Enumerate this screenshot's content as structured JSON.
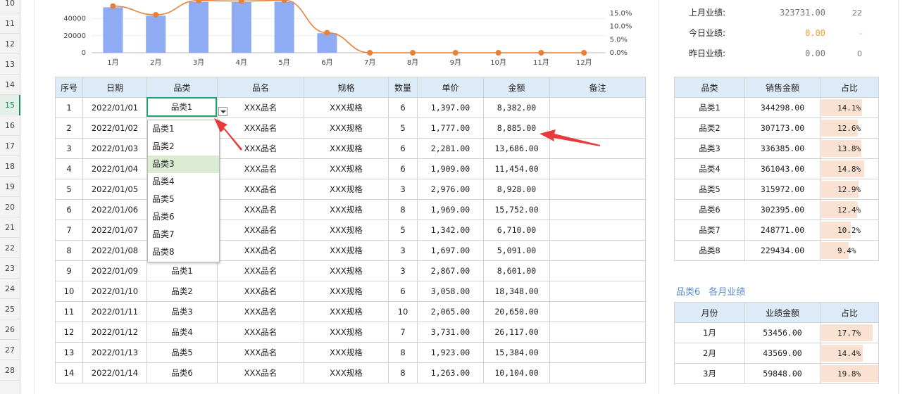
{
  "row_numbers": [
    "10",
    "11",
    "12",
    "13",
    "14",
    "15",
    "16",
    "17",
    "18",
    "19",
    "20",
    "21",
    "22",
    "23",
    "24",
    "25",
    "26",
    "27",
    "28"
  ],
  "active_row": "15",
  "chart_data": {
    "type": "bar+line",
    "categories": [
      "1月",
      "2月",
      "3月",
      "4月",
      "5月",
      "6月",
      "7月",
      "8月",
      "9月",
      "10月",
      "11月",
      "12月"
    ],
    "series": [
      {
        "type": "bar",
        "values": [
          53456,
          43569,
          59848,
          59500,
          60000,
          23000,
          0,
          0,
          0,
          0,
          0,
          0
        ]
      },
      {
        "type": "line",
        "values": [
          17.7,
          14.4,
          19.8,
          19.6,
          19.9,
          7.6,
          0,
          0,
          0,
          0,
          0,
          0
        ]
      }
    ],
    "y_ticks": [
      "0",
      "20000",
      "40000"
    ],
    "y2_ticks": [
      "0.0%",
      "5.0%",
      "10.0%",
      "15.0%"
    ],
    "ylim": [
      0,
      62000
    ],
    "y2lim": [
      0,
      20
    ],
    "bar_color": "#8fabf4",
    "line_color": "#e8803a"
  },
  "summary": [
    {
      "label": "上月业绩:",
      "value": "323731.00",
      "count": "22",
      "highlight": false
    },
    {
      "label": "今日业绩:",
      "value": "0.00",
      "count": "-",
      "highlight": true
    },
    {
      "label": "昨日业绩:",
      "value": "0.00",
      "count": "0",
      "highlight": false
    }
  ],
  "main_table": {
    "headers": [
      "序号",
      "日期",
      "品类",
      "品名",
      "规格",
      "数量",
      "单价",
      "金额",
      "备注"
    ],
    "rows": [
      [
        "1",
        "2022/01/01",
        "品类1",
        "XXX品名",
        "XXX规格",
        "6",
        "1,397.00",
        "8,382.00",
        ""
      ],
      [
        "2",
        "2022/01/02",
        "",
        "XXX品名",
        "XXX规格",
        "5",
        "1,777.00",
        "8,885.00",
        ""
      ],
      [
        "3",
        "2022/01/03",
        "",
        "XXX品名",
        "XXX规格",
        "6",
        "2,281.00",
        "13,686.00",
        ""
      ],
      [
        "4",
        "2022/01/04",
        "",
        "XXX品名",
        "XXX规格",
        "6",
        "1,909.00",
        "11,454.00",
        ""
      ],
      [
        "5",
        "2022/01/05",
        "",
        "XXX品名",
        "XXX规格",
        "3",
        "2,976.00",
        "8,928.00",
        ""
      ],
      [
        "6",
        "2022/01/06",
        "",
        "XXX品名",
        "XXX规格",
        "8",
        "1,969.00",
        "15,752.00",
        ""
      ],
      [
        "7",
        "2022/01/07",
        "",
        "XXX品名",
        "XXX规格",
        "5",
        "1,342.00",
        "6,710.00",
        ""
      ],
      [
        "8",
        "2022/01/08",
        "",
        "XXX品名",
        "XXX规格",
        "3",
        "1,697.00",
        "5,091.00",
        ""
      ],
      [
        "9",
        "2022/01/09",
        "品类1",
        "XXX品名",
        "XXX规格",
        "3",
        "2,867.00",
        "8,601.00",
        ""
      ],
      [
        "10",
        "2022/01/10",
        "品类2",
        "XXX品名",
        "XXX规格",
        "6",
        "3,058.00",
        "18,348.00",
        ""
      ],
      [
        "11",
        "2022/01/11",
        "品类3",
        "XXX品名",
        "XXX规格",
        "10",
        "2,065.00",
        "20,650.00",
        ""
      ],
      [
        "12",
        "2022/01/12",
        "品类4",
        "XXX品名",
        "XXX规格",
        "7",
        "3,731.00",
        "26,117.00",
        ""
      ],
      [
        "13",
        "2022/01/13",
        "品类5",
        "XXX品名",
        "XXX规格",
        "8",
        "1,923.00",
        "15,384.00",
        ""
      ],
      [
        "14",
        "2022/01/14",
        "品类6",
        "XXX品名",
        "XXX规格",
        "8",
        "1,263.00",
        "10,104.00",
        ""
      ]
    ]
  },
  "selected_cell_value": "品类1",
  "dropdown_options": [
    "品类1",
    "品类2",
    "品类3",
    "品类4",
    "品类5",
    "品类6",
    "品类7",
    "品类8"
  ],
  "dropdown_highlight_index": 2,
  "category_table": {
    "headers": [
      "品类",
      "销售金额",
      "占比"
    ],
    "rows": [
      {
        "name": "品类1",
        "amount": "344298.00",
        "pct": "14.1%",
        "fraction": 0.141
      },
      {
        "name": "品类2",
        "amount": "307173.00",
        "pct": "12.6%",
        "fraction": 0.126
      },
      {
        "name": "品类3",
        "amount": "336385.00",
        "pct": "13.8%",
        "fraction": 0.138
      },
      {
        "name": "品类4",
        "amount": "361043.00",
        "pct": "14.8%",
        "fraction": 0.148
      },
      {
        "name": "品类5",
        "amount": "315972.00",
        "pct": "12.9%",
        "fraction": 0.129
      },
      {
        "name": "品类6",
        "amount": "302395.00",
        "pct": "12.4%",
        "fraction": 0.124
      },
      {
        "name": "品类7",
        "amount": "248771.00",
        "pct": "10.2%",
        "fraction": 0.102
      },
      {
        "name": "品类8",
        "amount": "229434.00",
        "pct": "9.4%",
        "fraction": 0.094
      }
    ]
  },
  "monthly_title": {
    "category": "品类6",
    "label": "各月业绩"
  },
  "monthly_table": {
    "headers": [
      "月份",
      "业绩金额",
      "占比"
    ],
    "rows": [
      {
        "month": "1月",
        "amount": "53456.00",
        "pct": "17.7%",
        "fraction": 0.177
      },
      {
        "month": "2月",
        "amount": "43569.00",
        "pct": "14.4%",
        "fraction": 0.144
      },
      {
        "month": "3月",
        "amount": "59848.00",
        "pct": "19.8%",
        "fraction": 0.198
      }
    ]
  },
  "arrow_color": "#e83a3a"
}
